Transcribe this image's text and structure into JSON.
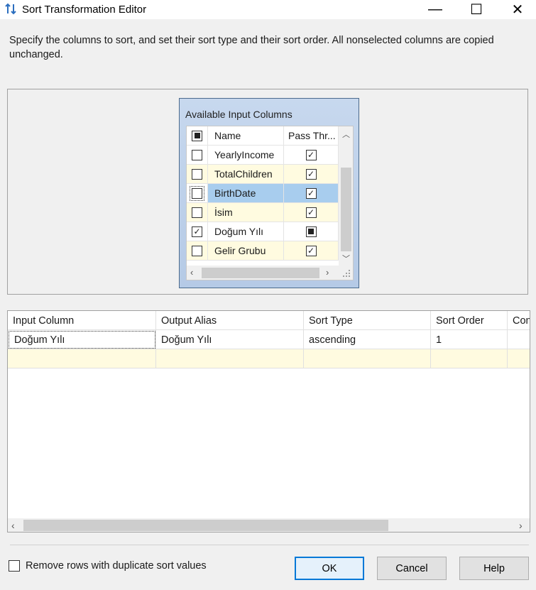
{
  "window": {
    "title": "Sort Transformation Editor",
    "controls": {
      "minimize": "—",
      "maximize": "☐",
      "close": "✕"
    }
  },
  "description": "Specify the columns to sort, and set their sort type and their sort order. All nonselected columns are copied unchanged.",
  "available_columns": {
    "title": "Available Input Columns",
    "headers": {
      "name": "Name",
      "pass_through": "Pass Thr..."
    },
    "rows": [
      {
        "name": "YearlyIncome",
        "selected": false,
        "pass_through": "checked"
      },
      {
        "name": "TotalChildren",
        "selected": false,
        "pass_through": "checked"
      },
      {
        "name": "BirthDate",
        "selected": false,
        "pass_through": "checked"
      },
      {
        "name": "İsim",
        "selected": false,
        "pass_through": "checked"
      },
      {
        "name": "Doğum Yılı",
        "selected": true,
        "pass_through": "indeterminate"
      },
      {
        "name": "Gelir Grubu",
        "selected": false,
        "pass_through": "checked"
      }
    ]
  },
  "sort_grid": {
    "headers": [
      "Input Column",
      "Output Alias",
      "Sort Type",
      "Sort Order",
      "Con"
    ],
    "rows": [
      [
        "Doğum Yılı",
        "Doğum Yılı",
        "ascending",
        "1",
        ""
      ]
    ]
  },
  "remove_duplicates": {
    "label": "Remove rows with duplicate sort values",
    "checked": false
  },
  "buttons": {
    "ok": "OK",
    "cancel": "Cancel",
    "help": "Help"
  },
  "colors": {
    "selected_row": "#a8cdee",
    "alt_row": "#fffbe0",
    "default_button_border": "#0078d7"
  }
}
